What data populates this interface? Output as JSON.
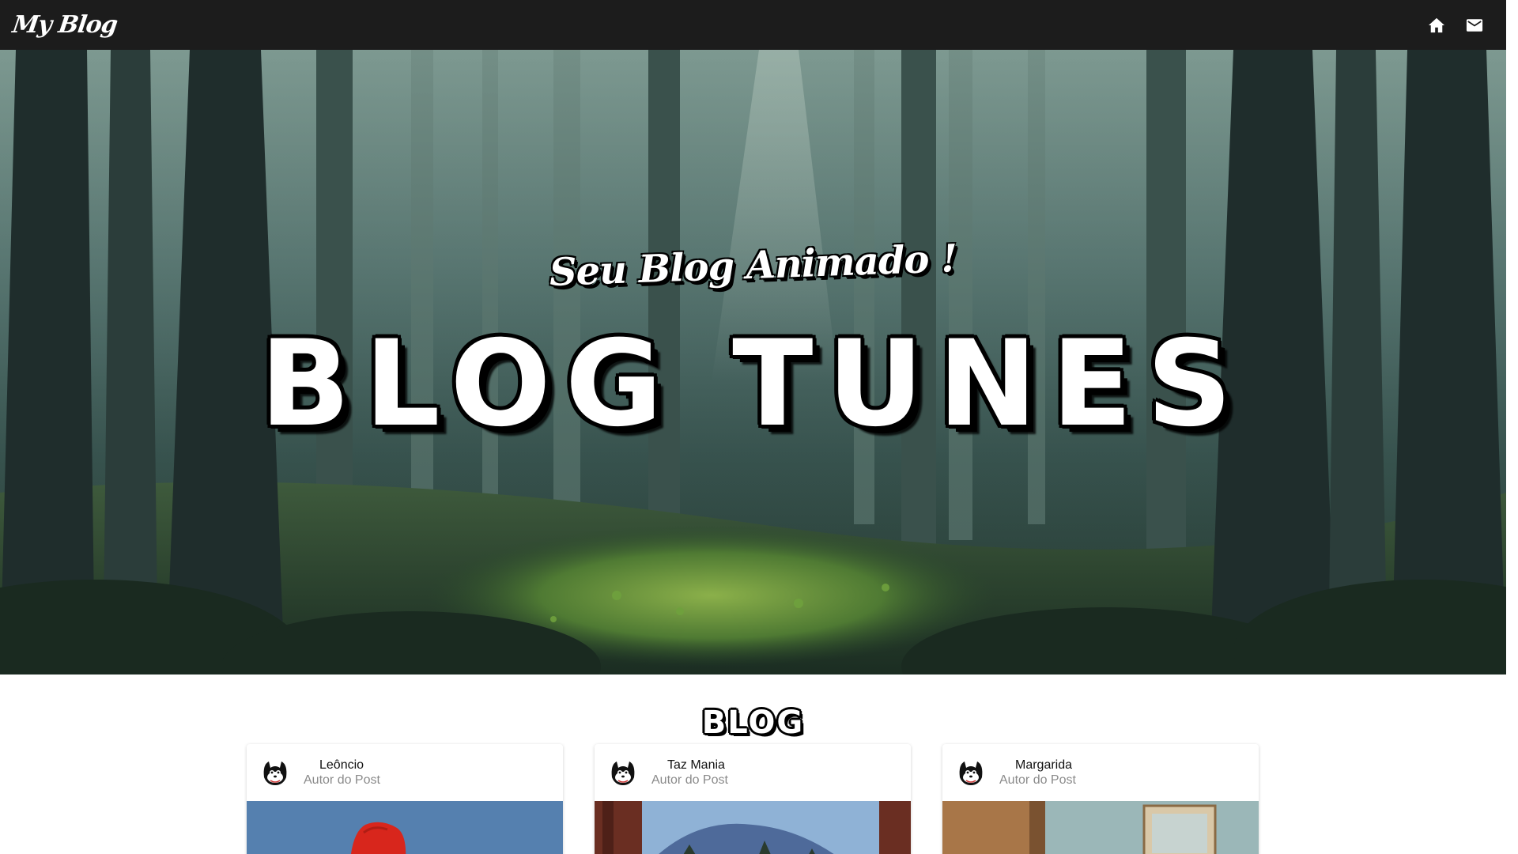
{
  "navbar": {
    "brand": "My Blog",
    "home_icon": "home-icon",
    "mail_icon": "mail-icon"
  },
  "hero": {
    "subtitle": "Seu Blog Animado !",
    "title": "BLOG TUNES"
  },
  "blog": {
    "section_title": "BLOG",
    "cards": [
      {
        "author": "Leôncio",
        "role": "Autor do Post"
      },
      {
        "author": "Taz Mania",
        "role": "Autor do Post"
      },
      {
        "author": "Margarida",
        "role": "Autor do Post"
      }
    ]
  },
  "colors": {
    "navbar_bg": "#1c1c1c",
    "text_dark": "#111111",
    "text_muted": "#8a8a8a"
  }
}
